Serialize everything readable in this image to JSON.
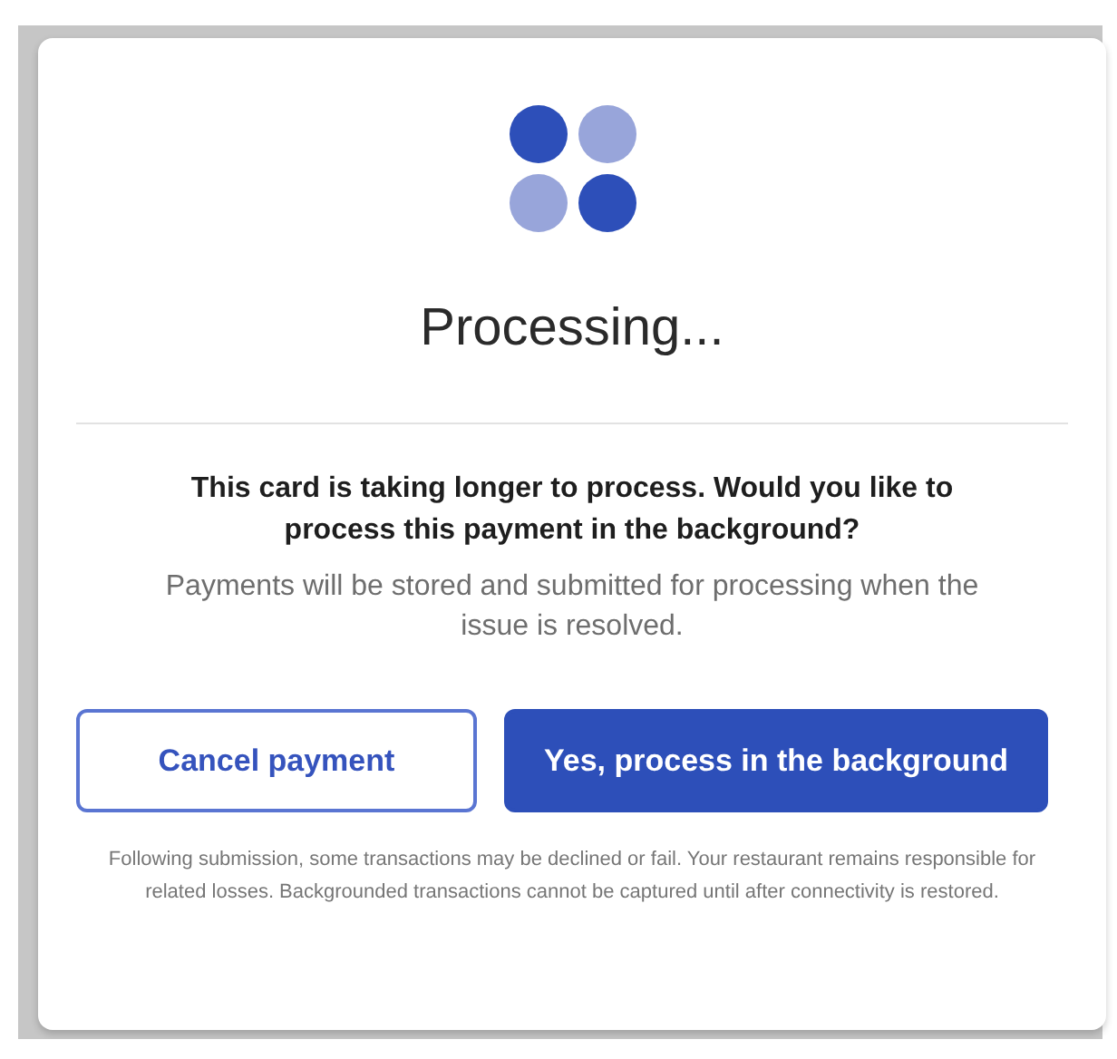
{
  "spinner": {
    "dots": [
      {
        "color": "#2d4fb9"
      },
      {
        "color": "#98a5da"
      },
      {
        "color": "#98a5da"
      },
      {
        "color": "#2d4fb9"
      }
    ]
  },
  "title": "Processing...",
  "question": "This card is taking longer to process. Would you like to process this payment in the background?",
  "note": "Payments will be stored and submitted for processing when the issue is resolved.",
  "buttons": [
    {
      "label": "Cancel payment",
      "kind": "secondary"
    },
    {
      "label": "Yes, process in the background",
      "kind": "primary"
    }
  ],
  "disclaimer": "Following submission, some transactions may be declined or fail. Your restaurant remains responsible for related losses. Backgrounded transactions cannot be captured until after connectivity is restored."
}
